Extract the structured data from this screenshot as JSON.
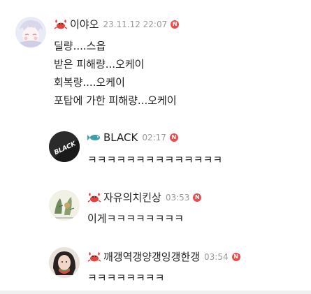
{
  "comments": [
    {
      "nick": "이야오",
      "badge": "crab-icon",
      "time": "23.11.12 22:07",
      "new_badge": "N",
      "lines": [
        "딜량....스읍",
        "받은 피해량...오케이",
        "회복량....오케이",
        "포탑에 가한 피해량...오케이"
      ]
    },
    {
      "nick": "BLACK",
      "badge": "fish-icon",
      "avatar_text": "BLACK",
      "time": "02:17",
      "new_badge": "N",
      "lines": [
        "ㅋㅋㅋㅋㅋㅋㅋㅋㅋㅋㅋㅋㅋㅋ"
      ]
    },
    {
      "nick": "자유의치킨상",
      "badge": "crab-icon",
      "time": "03:53",
      "new_badge": "N",
      "lines": [
        "이게ㅋㅋㅋㅋㅋㅋㅋㅋ"
      ]
    },
    {
      "nick": "깨갱역갱양갱잉갱한갱",
      "badge": "crab-icon",
      "time": "03:54",
      "new_badge": "N",
      "lines": [
        "ㅋㅋㅋㅋㅋㅋㅋㅋ"
      ]
    }
  ]
}
